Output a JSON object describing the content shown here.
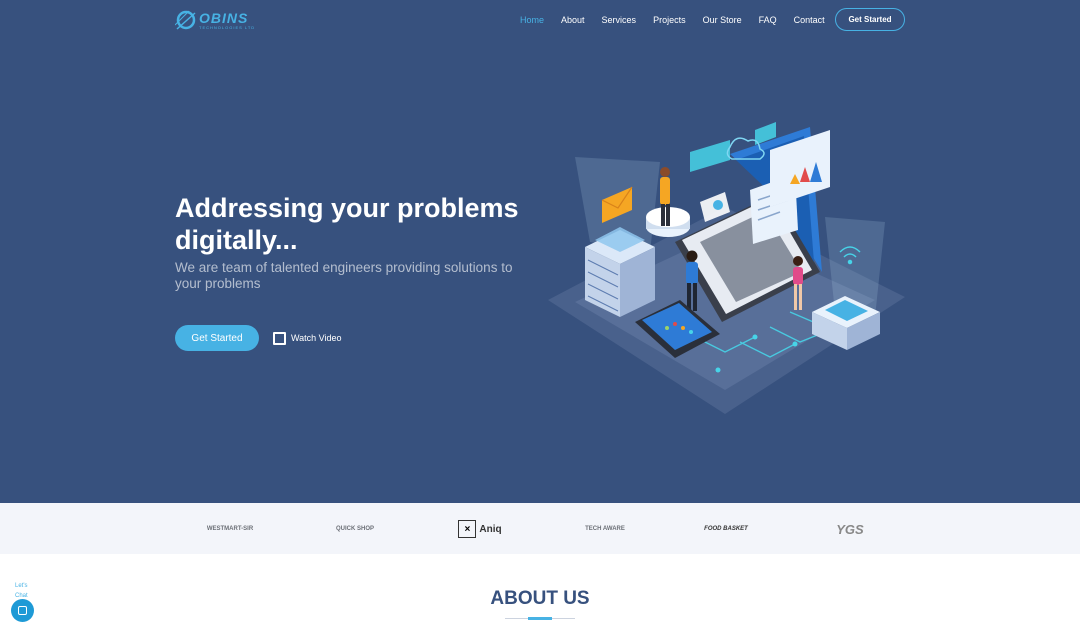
{
  "brand": {
    "name": "OBINS",
    "subtitle": "TECHNOLOGIES LTD"
  },
  "nav": {
    "items": [
      {
        "label": "Home",
        "active": true
      },
      {
        "label": "About"
      },
      {
        "label": "Services"
      },
      {
        "label": "Projects"
      },
      {
        "label": "Our Store"
      },
      {
        "label": "FAQ"
      },
      {
        "label": "Contact"
      }
    ],
    "cta_label": "Get Started"
  },
  "hero": {
    "title": "Addressing your problems digitally...",
    "subtitle": "We are team of talented engineers providing solutions to your problems",
    "primary_button": "Get Started",
    "video_label": "Watch Video",
    "illustration_icon": "isometric-tech-illustration"
  },
  "clients": [
    {
      "label": "WESTMART-SIR"
    },
    {
      "label": "QUICK SHOP"
    },
    {
      "label": "Aniq"
    },
    {
      "label": "TECH AWARE"
    },
    {
      "label": "FOOD BASKET"
    },
    {
      "label": "YGS"
    }
  ],
  "about": {
    "title": "ABOUT US"
  },
  "chat": {
    "label": "Let's Chat",
    "icon": "chat-icon"
  },
  "colors": {
    "hero_bg": "#37517e",
    "accent": "#47b2e4",
    "clients_bg": "#f3f5fa",
    "heading": "#37517e"
  }
}
